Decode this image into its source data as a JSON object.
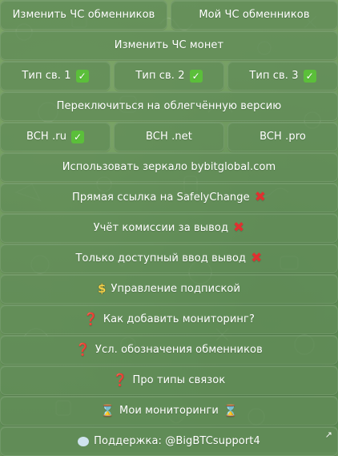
{
  "rows": {
    "r1": [
      "Изменить ЧС обменников",
      "Мой ЧС обменников"
    ],
    "r2": "Изменить ЧС монет",
    "r3": [
      "Тип св. 1",
      "Тип св. 2",
      "Тип св. 3"
    ],
    "r4": "Переключиться на облегчённую версию",
    "r5": [
      "BCH .ru",
      "BCH .net",
      "BCH .pro"
    ],
    "r6": "Использовать зеркало bybitglobal.com",
    "r7": "Прямая ссылка на SafelyChange",
    "r8": "Учёт комиссии за вывод",
    "r9": "Только доступный ввод вывод",
    "r10": "Управление подпиской",
    "r11": "Как добавить мониторинг?",
    "r12": "Усл. обозначения обменников",
    "r13": "Про типы связок",
    "r14": "Мои мониторинги",
    "r15": "Поддержка: @BigBTCsupport4"
  },
  "icons": {
    "check": "✓",
    "cross": "✖",
    "question": "❓",
    "dollar": "$",
    "hourglass": "⌛",
    "external": "↗"
  },
  "colors": {
    "button_bg": "#628c58",
    "check_green": "#5bbf3a",
    "cross_red": "#e03030"
  }
}
